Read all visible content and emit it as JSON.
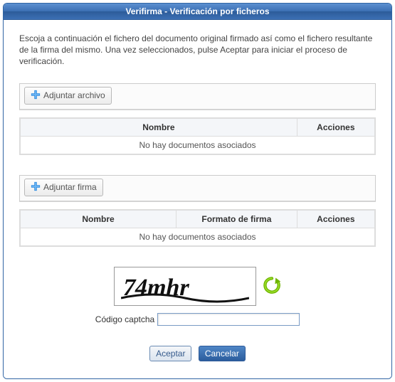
{
  "header": {
    "title": "Verifirma - Verificación por ficheros"
  },
  "intro": "Escoja a continuación el fichero del documento original firmado así como el fichero resultante de la firma del mismo. Una vez seleccionados, pulse Aceptar para iniciar el proceso de verificación.",
  "attachFile": {
    "button_label": "Adjuntar archivo",
    "columns": {
      "name": "Nombre",
      "actions": "Acciones"
    },
    "empty_text": "No hay documentos asociados"
  },
  "attachSignature": {
    "button_label": "Adjuntar firma",
    "columns": {
      "name": "Nombre",
      "format": "Formato de firma",
      "actions": "Acciones"
    },
    "empty_text": "No hay documentos asociados"
  },
  "captcha": {
    "value": "74mhr",
    "label": "Código captcha",
    "input_value": ""
  },
  "actions": {
    "accept": "Aceptar",
    "cancel": "Cancelar"
  }
}
